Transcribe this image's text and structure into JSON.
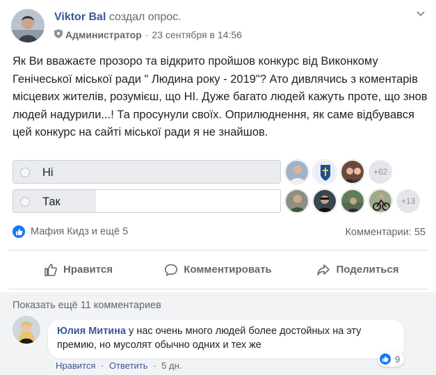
{
  "post": {
    "author": "Viktor Bal",
    "action": "создал опрос.",
    "role": "Администратор",
    "timestamp": "23 сентября в 14:56",
    "text": "Як Ви вважаєте прозоро та відкрито пройшов конкурс від Виконкому Генічеської міської ради \" Людина року - 2019\"? Ато дивлячись з коментарів місцевих жителів, розумієш, що НІ. Дуже багато людей кажуть проте, що знов людей надурили...! Та просунули своїх. Оприлюднення, як саме відбувався цей конкурс на сайті міської ради я не знайшов."
  },
  "poll": {
    "options": [
      {
        "label": "Ні",
        "share": 1.0,
        "more": "+62"
      },
      {
        "label": "Так",
        "share": 0.31,
        "more": "+13"
      }
    ]
  },
  "stats": {
    "likes_text": "Мафия Кидз и ещё 5",
    "comments_text": "Комментарии: 55"
  },
  "actions": {
    "like": "Нравится",
    "comment": "Комментировать",
    "share": "Поделиться"
  },
  "comments": {
    "show_more": "Показать ещё 11 комментариев",
    "items": [
      {
        "author": "Юлия Митина",
        "text": "у нас очень много людей более достойных на эту премию, но мусолят обычно одних и тех же",
        "like_action": "Нравится",
        "reply_action": "Ответить",
        "age": "5 дн.",
        "reaction_count": "9"
      }
    ]
  },
  "colors": {
    "link": "#385898",
    "like_blue": "#1877f2",
    "muted": "#606770"
  }
}
